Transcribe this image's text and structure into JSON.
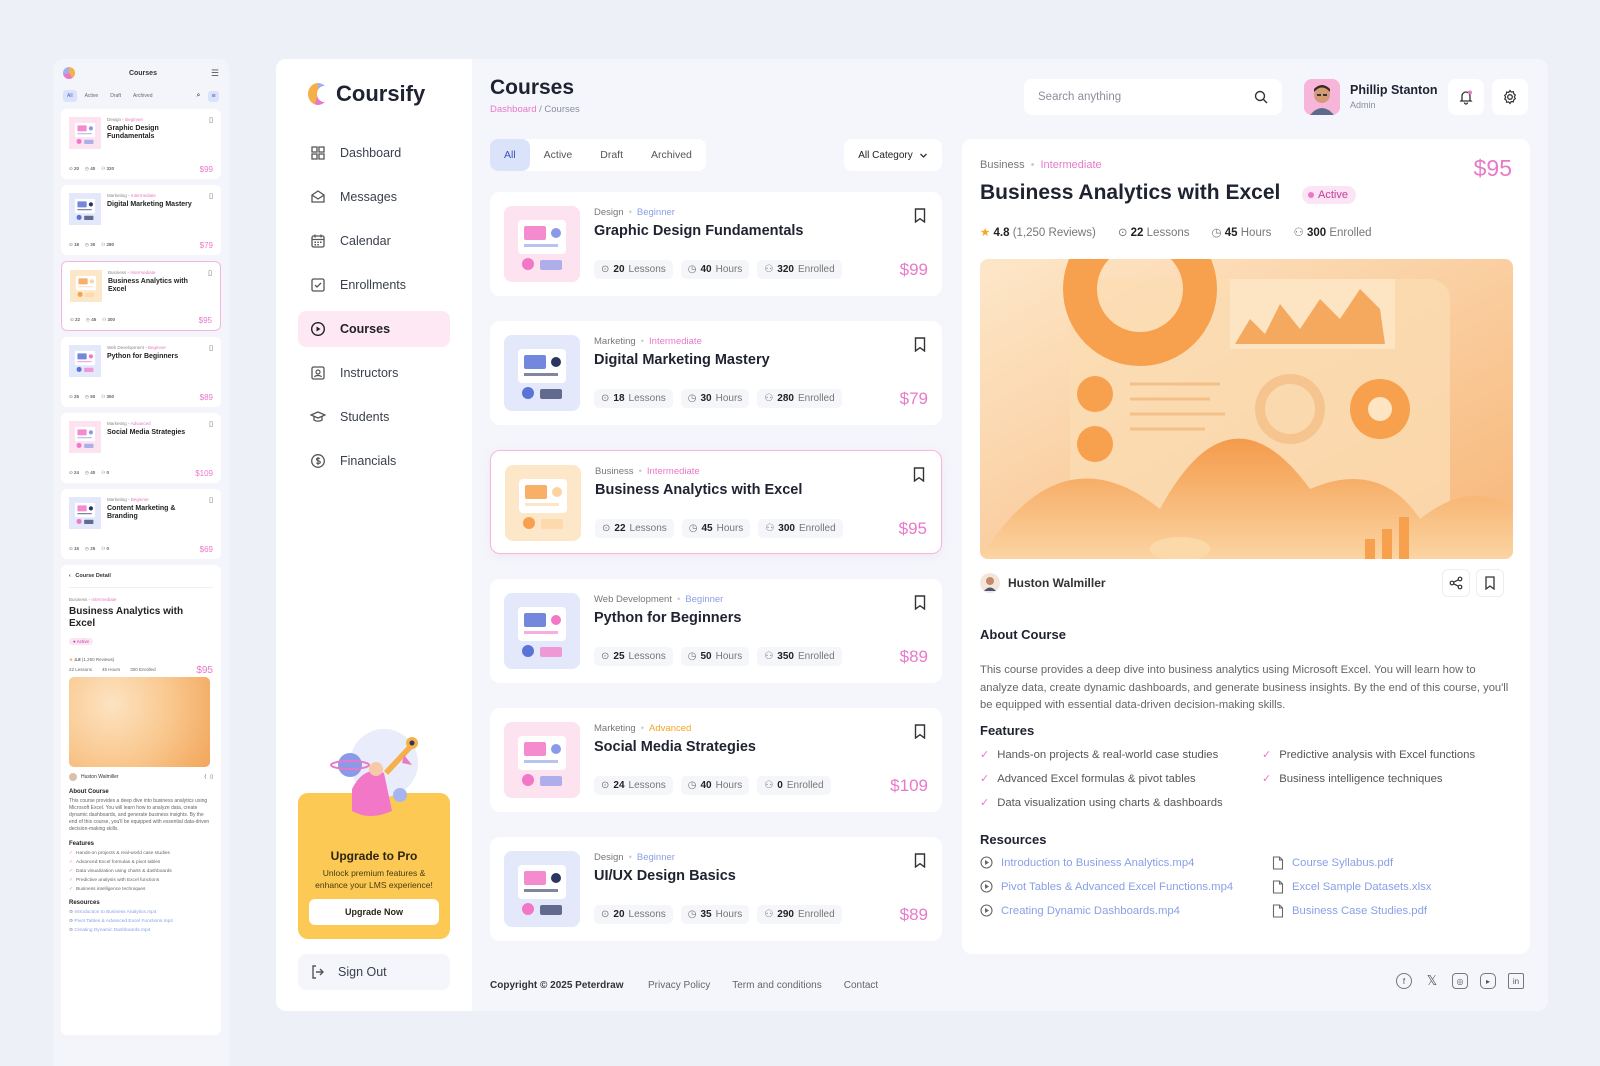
{
  "mobile": {
    "title": "Courses",
    "tabs": [
      "All",
      "Active",
      "Draft",
      "Archived"
    ],
    "cards": [
      {
        "category": "Design",
        "level": "Beginner",
        "name": "Graphic Design Fundamentals",
        "lessons": "20",
        "hours": "40",
        "enrolled": "320",
        "price": "$99"
      },
      {
        "category": "Marketing",
        "level": "Intermediate",
        "name": "Digital Marketing Mastery",
        "lessons": "18",
        "hours": "30",
        "enrolled": "280",
        "price": "$79"
      },
      {
        "category": "Business",
        "level": "Intermediate",
        "name": "Business Analytics with Excel",
        "lessons": "22",
        "hours": "45",
        "enrolled": "300",
        "price": "$95"
      },
      {
        "category": "Web Development",
        "level": "Beginner",
        "name": "Python for Beginners",
        "lessons": "25",
        "hours": "50",
        "enrolled": "350",
        "price": "$89"
      },
      {
        "category": "Marketing",
        "level": "Advanced",
        "name": "Social Media Strategies",
        "lessons": "24",
        "hours": "40",
        "enrolled": "0",
        "price": "$109"
      },
      {
        "category": "Marketing",
        "level": "Beginner",
        "name": "Content Marketing & Branding",
        "lessons": "15",
        "hours": "25",
        "enrolled": "0",
        "price": "$69"
      }
    ],
    "detail": {
      "back_label": "Course Detail",
      "category": "Business",
      "level": "Intermediate",
      "title": "Business Analytics with Excel",
      "status": "Active",
      "price": "$95",
      "rating": "4.8",
      "reviews": "(1,250 Reviews)",
      "lessons": "22 Lessons",
      "hours": "45 Hours",
      "enrolled": "300 Enrolled",
      "instructor": "Huston Walmiller",
      "about_heading": "About Course",
      "about": "This course provides a deep dive into business analytics using Microsoft Excel. You will learn how to analyze data, create dynamic dashboards, and generate business insights. By the end of this course, you'll be equipped with essential data-driven decision-making skills.",
      "features_heading": "Features",
      "features": [
        "Hands-on projects & real-world case studies",
        "Advanced Excel formulas & pivot tables",
        "Data visualization using charts & dashboards",
        "Predictive analysis with Excel functions",
        "Business intelligence techniques"
      ],
      "resources_heading": "Resources",
      "resources": [
        "Introduction to Business Analytics.mp4",
        "Pivot Tables & Advanced Excel Functions.mp4",
        "Creating Dynamic Dashboards.mp4"
      ]
    }
  },
  "brand": {
    "name": "Coursify"
  },
  "nav": [
    {
      "label": "Dashboard",
      "icon": "grid-icon"
    },
    {
      "label": "Messages",
      "icon": "mail-icon"
    },
    {
      "label": "Calendar",
      "icon": "calendar-icon"
    },
    {
      "label": "Enrollments",
      "icon": "checkbox-icon"
    },
    {
      "label": "Courses",
      "icon": "play-circle-icon",
      "active": true
    },
    {
      "label": "Instructors",
      "icon": "id-card-icon"
    },
    {
      "label": "Students",
      "icon": "graduation-cap-icon"
    },
    {
      "label": "Financials",
      "icon": "dollar-circle-icon"
    }
  ],
  "upgrade": {
    "title": "Upgrade to Pro",
    "subtitle": "Unlock premium features & enhance your LMS experience!",
    "button": "Upgrade Now"
  },
  "signout": "Sign Out",
  "header": {
    "title": "Courses",
    "breadcrumb_root": "Dashboard",
    "breadcrumb_sep": "/",
    "breadcrumb_current": "Courses",
    "search_placeholder": "Search anything",
    "user_name": "Phillip Stanton",
    "user_role": "Admin"
  },
  "filters": {
    "tabs": [
      "All",
      "Active",
      "Draft",
      "Archived"
    ],
    "category": "All Category"
  },
  "labels": {
    "lessons": "Lessons",
    "hours": "Hours",
    "enrolled": "Enrolled"
  },
  "courses": [
    {
      "category": "Design",
      "level": "Beginner",
      "level_color": "blue",
      "name": "Graphic Design Fundamentals",
      "lessons": "20",
      "hours": "40",
      "enrolled": "320",
      "price": "$99"
    },
    {
      "category": "Marketing",
      "level": "Intermediate",
      "level_color": "pink",
      "name": "Digital Marketing Mastery",
      "lessons": "18",
      "hours": "30",
      "enrolled": "280",
      "price": "$79"
    },
    {
      "category": "Business",
      "level": "Intermediate",
      "level_color": "pink",
      "name": "Business Analytics with Excel",
      "lessons": "22",
      "hours": "45",
      "enrolled": "300",
      "price": "$95",
      "selected": true
    },
    {
      "category": "Web Development",
      "level": "Beginner",
      "level_color": "blue",
      "name": "Python for Beginners",
      "lessons": "25",
      "hours": "50",
      "enrolled": "350",
      "price": "$89"
    },
    {
      "category": "Marketing",
      "level": "Advanced",
      "level_color": "orange",
      "name": "Social Media Strategies",
      "lessons": "24",
      "hours": "40",
      "enrolled": "0",
      "price": "$109"
    },
    {
      "category": "Design",
      "level": "Beginner",
      "level_color": "blue",
      "name": "UI/UX Design Basics",
      "lessons": "20",
      "hours": "35",
      "enrolled": "290",
      "price": "$89"
    }
  ],
  "detail": {
    "category": "Business",
    "level": "Intermediate",
    "price": "$95",
    "title": "Business Analytics with Excel",
    "status": "Active",
    "rating": "4.8",
    "reviews": "(1,250 Reviews)",
    "lessons": "22",
    "hours": "45",
    "enrolled": "300",
    "instructor": "Huston Walmiller",
    "about_heading": "About Course",
    "about": "This course provides a deep dive into business analytics using Microsoft Excel. You will learn how to analyze data, create dynamic dashboards, and generate business insights. By the end of this course, you'll be equipped with essential data-driven decision-making skills.",
    "features_heading": "Features",
    "features": [
      "Hands-on projects & real-world case studies",
      "Advanced Excel formulas & pivot tables",
      "Data visualization using charts & dashboards",
      "Predictive analysis with Excel functions",
      "Business intelligence techniques"
    ],
    "resources_heading": "Resources",
    "resources_video": [
      "Introduction to Business Analytics.mp4",
      "Pivot Tables & Advanced Excel Functions.mp4",
      "Creating Dynamic Dashboards.mp4"
    ],
    "resources_docs": [
      "Course Syllabus.pdf",
      "Excel Sample Datasets.xlsx",
      "Business Case Studies.pdf"
    ]
  },
  "footer": {
    "copyright": "Copyright © 2025 Peterdraw",
    "links": [
      "Privacy Policy",
      "Term and conditions",
      "Contact"
    ],
    "social": [
      "facebook-icon",
      "x-icon",
      "instagram-icon",
      "youtube-icon",
      "linkedin-icon"
    ]
  },
  "colors": {
    "accent_pink": "#e879c9",
    "accent_blue": "#8aa0e6",
    "upgrade_yellow": "#fbc954",
    "advanced_orange": "#f5a623"
  }
}
